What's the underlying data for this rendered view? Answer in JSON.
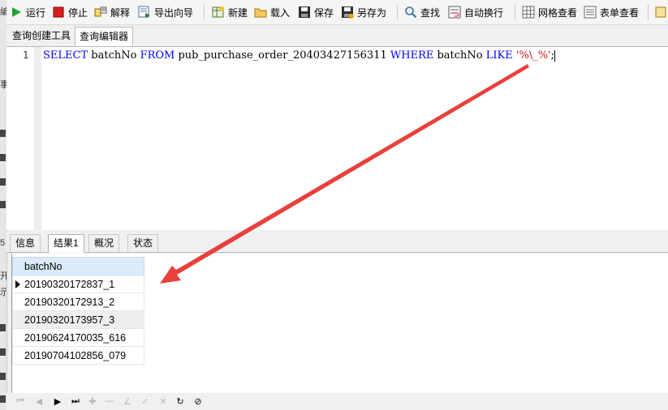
{
  "toolbar": {
    "run": "运行",
    "stop": "停止",
    "explain": "解释",
    "export_wizard": "导出向导",
    "new": "新建",
    "load": "载入",
    "save": "保存",
    "save_as": "另存为",
    "find": "查找",
    "word_wrap": "自动换行",
    "grid_view": "网格查看",
    "form_view": "表单查看"
  },
  "tabs": [
    "查询创建工具",
    "查询编辑器"
  ],
  "editor": {
    "line_number": "1",
    "sql": {
      "k1": "SELECT",
      "t1": " batchNo ",
      "k2": "FROM",
      "t2": " pub_purchase_order_20403427156311 ",
      "k3": "WHERE",
      "t3": " batchNo ",
      "k4": "LIKE",
      "t4": " ",
      "s1": "'%\\_%'",
      "t5": ";"
    }
  },
  "result_tabs": [
    "信息",
    "结果1",
    "概况",
    "状态"
  ],
  "grid": {
    "column": "batchNo",
    "rows": [
      "20190320172837_1",
      "20190320172913_2",
      "20190320173957_3",
      "20190624170035_616",
      "20190704102856_079"
    ],
    "current_row": 1,
    "selected_row": 3
  },
  "left_strip_glyphs": [
    "编",
    "事",
    "开",
    "示",
    "5"
  ],
  "colors": {
    "keyword": "#0000ff",
    "string": "#c71515",
    "arrow": "#e8403c",
    "header_bg": "#dcebf9"
  },
  "icons": {
    "run": "play-icon",
    "stop": "stop-icon",
    "explain": "explain-icon",
    "export_wizard": "export-icon",
    "new": "new-icon",
    "load": "folder-icon",
    "save": "floppy-icon",
    "save_as": "floppy-save-as-icon",
    "find": "magnifier-icon",
    "word_wrap": "wrap-icon",
    "grid_view": "grid-icon",
    "form_view": "form-icon"
  }
}
